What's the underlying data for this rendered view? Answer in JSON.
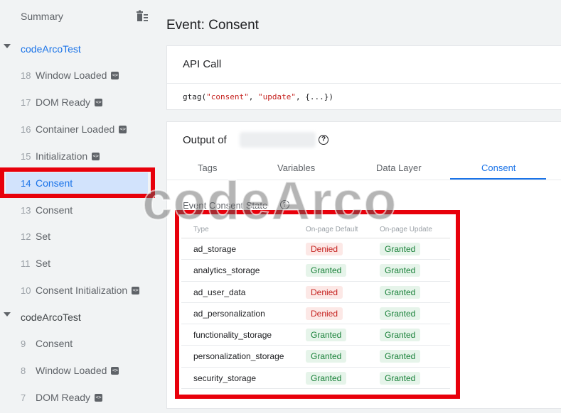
{
  "sidebar": {
    "summary_label": "Summary",
    "groups": [
      {
        "label": "codeArcoTest",
        "items": [
          {
            "num": "18",
            "name": "Window Loaded",
            "code": true
          },
          {
            "num": "17",
            "name": "DOM Ready",
            "code": true
          },
          {
            "num": "16",
            "name": "Container Loaded",
            "code": true
          },
          {
            "num": "15",
            "name": "Initialization",
            "code": true
          },
          {
            "num": "14",
            "name": "Consent",
            "code": false
          },
          {
            "num": "13",
            "name": "Consent",
            "code": false
          },
          {
            "num": "12",
            "name": "Set",
            "code": false
          },
          {
            "num": "11",
            "name": "Set",
            "code": false
          },
          {
            "num": "10",
            "name": "Consent Initialization",
            "code": true
          }
        ]
      },
      {
        "label": "codeArcoTest",
        "items": [
          {
            "num": "9",
            "name": "Consent",
            "code": false
          },
          {
            "num": "8",
            "name": "Window Loaded",
            "code": true
          },
          {
            "num": "7",
            "name": "DOM Ready",
            "code": true
          }
        ]
      }
    ],
    "code_glyph": "<>"
  },
  "main": {
    "title": "Event: Consent",
    "api_call": {
      "title": "API Call",
      "code_fn": "gtag(",
      "code_arg1": "\"consent\"",
      "code_sep": ", ",
      "code_arg2": "\"update\"",
      "code_rest": ", {...})"
    },
    "output": {
      "title": "Output of",
      "help_glyph": "?",
      "tabs": [
        "Tags",
        "Variables",
        "Data Layer",
        "Consent"
      ],
      "active_tab": "Consent",
      "consent_state_label": "Event Consent State",
      "table": {
        "headers": [
          "Type",
          "On-page Default",
          "On-page Update"
        ],
        "rows": [
          {
            "type": "ad_storage",
            "default": "Denied",
            "update": "Granted"
          },
          {
            "type": "analytics_storage",
            "default": "Granted",
            "update": "Granted"
          },
          {
            "type": "ad_user_data",
            "default": "Denied",
            "update": "Granted"
          },
          {
            "type": "ad_personalization",
            "default": "Denied",
            "update": "Granted"
          },
          {
            "type": "functionality_storage",
            "default": "Granted",
            "update": "Granted"
          },
          {
            "type": "personalization_storage",
            "default": "Granted",
            "update": "Granted"
          },
          {
            "type": "security_storage",
            "default": "Granted",
            "update": "Granted"
          }
        ]
      }
    }
  },
  "watermark": "codeArco",
  "colors": {
    "accent": "#1a73e8",
    "highlight_outline": "#e8000b",
    "denied_bg": "#fce8e6",
    "denied_text": "#c5221f",
    "granted_bg": "#e6f4ea",
    "granted_text": "#188038"
  }
}
